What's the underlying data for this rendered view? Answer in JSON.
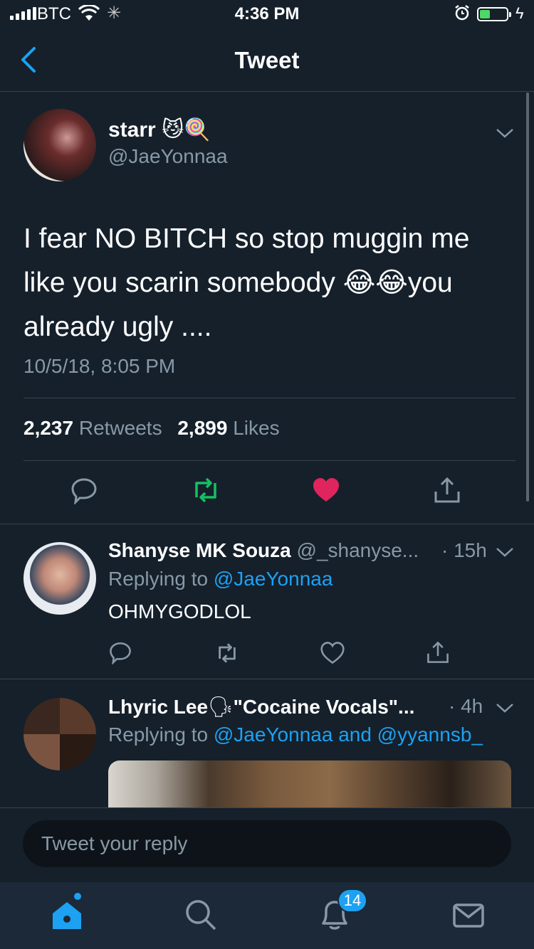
{
  "status_bar": {
    "carrier": "BTC",
    "time": "4:36 PM"
  },
  "nav": {
    "title": "Tweet"
  },
  "main_tweet": {
    "author_name": "starr",
    "author_emoji": "😼🍭",
    "handle": "@JaeYonnaa",
    "text": "I fear NO BITCH so stop muggin me like you scarin somebody 😂😂you already ugly ....",
    "timestamp": "10/5/18, 8:05 PM",
    "retweets_count": "2,237",
    "retweets_label": "Retweets",
    "likes_count": "2,899",
    "likes_label": "Likes",
    "liked": true,
    "colors": {
      "retweet": "#17bf63",
      "like": "#e0245e",
      "link": "#1da1f2"
    }
  },
  "replies": [
    {
      "name": "Shanyse MK Souza",
      "handle": "@_shanyse...",
      "time": "· 15h",
      "replying_prefix": "Replying to",
      "replying_to": "@JaeYonnaa",
      "text": "OHMYGODLOL"
    },
    {
      "name": "Lhyric Lee",
      "name_emoji": "🗣",
      "name_suffix": "\"Cocaine Vocals\"...",
      "time": "· 4h",
      "replying_prefix": "Replying to",
      "replying_to": "@JaeYonnaa and @yyannsb_"
    }
  ],
  "composer": {
    "placeholder": "Tweet your reply"
  },
  "tabbar": {
    "notifications_badge": "14",
    "icons": [
      "home-icon",
      "search-icon",
      "notifications-icon",
      "messages-icon"
    ]
  }
}
